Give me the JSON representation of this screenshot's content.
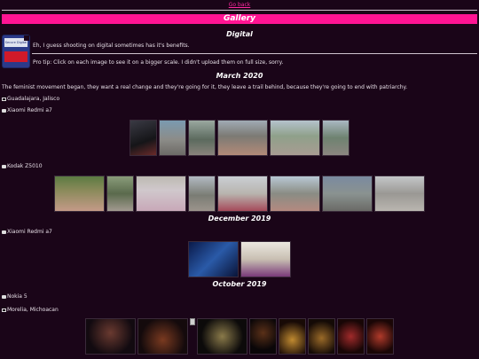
{
  "nav": {
    "go_back": "Go back"
  },
  "banner": {
    "title": "Gallery"
  },
  "intro": {
    "heading": "Digital",
    "line1": "Eh, I guess shooting on digital sometimes has it's benefits.",
    "line2": "Pro tip: Click on each image to see it on a bigger scale. I didn't upload them on full size, sorry.",
    "card_label": "Secure Digital"
  },
  "sections": {
    "march_2020": {
      "heading": "March 2020",
      "quote": "The feminist movement began, they want a real change and they're going for it, they leave a trail behind, because they're going to end with patriarchy.",
      "location": "Guadalajara, Jalisco",
      "camera1": "Xiaomi Redmi a7",
      "camera2": "Kodak Z5010"
    },
    "december_2019": {
      "heading": "December 2019",
      "camera": "Xiaomi Redmi a7"
    },
    "october_2019": {
      "heading": "October 2019",
      "camera": "Nokia 5",
      "location": "Morelia, Michoacan"
    }
  },
  "colors": {
    "accent": "#ff1493",
    "link": "#ff2aa0",
    "background": "#1a0518"
  }
}
